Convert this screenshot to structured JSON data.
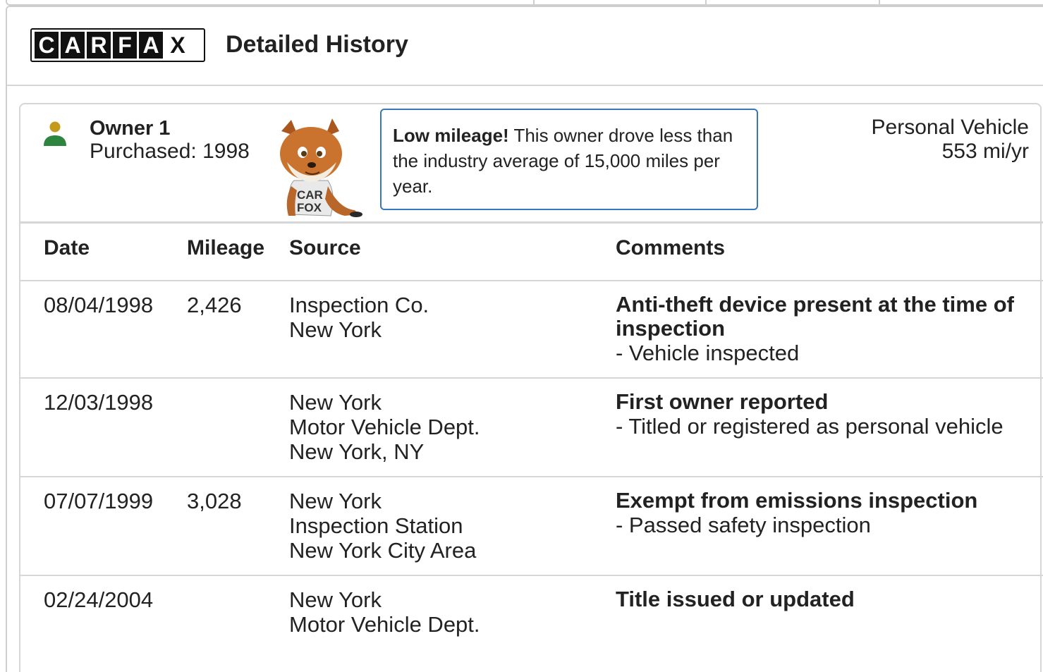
{
  "header": {
    "title": "Detailed History",
    "logo_letters": [
      "C",
      "A",
      "R",
      "F",
      "A",
      "X"
    ]
  },
  "owner": {
    "name": "Owner 1",
    "purchased": "Purchased: 1998",
    "icon": "person-icon",
    "colors": {
      "head": "#c49a1a",
      "body": "#2e8540"
    }
  },
  "callout": {
    "bold": "Low mileage!",
    "text": " This owner drove less than the industry average of 15,000 miles per year.",
    "border_color": "#3777bc"
  },
  "vehicle": {
    "type": "Personal Vehicle",
    "mileage": "553 mi/yr"
  },
  "table": {
    "headers": {
      "date": "Date",
      "mileage": "Mileage",
      "source": "Source",
      "comments": "Comments"
    },
    "rows": [
      {
        "date": "08/04/1998",
        "mileage": "2,426",
        "source": [
          "Inspection Co.",
          "New York"
        ],
        "comment_title": "Anti-theft device present at the time of inspection",
        "comment_items": [
          "- Vehicle inspected"
        ]
      },
      {
        "date": "12/03/1998",
        "mileage": "",
        "source": [
          "New York",
          "Motor Vehicle Dept.",
          "New York, NY"
        ],
        "comment_title": "First owner reported",
        "comment_items": [
          "- Titled or registered as personal vehicle"
        ]
      },
      {
        "date": "07/07/1999",
        "mileage": "3,028",
        "source": [
          "New York",
          "Inspection Station",
          "New York City Area"
        ],
        "comment_title": "Exempt from emissions inspection",
        "comment_items": [
          "- Passed safety inspection"
        ]
      },
      {
        "date": "02/24/2004",
        "mileage": "",
        "source": [
          "New York",
          "Motor Vehicle Dept."
        ],
        "comment_title": "Title issued or updated",
        "comment_items": []
      }
    ]
  }
}
